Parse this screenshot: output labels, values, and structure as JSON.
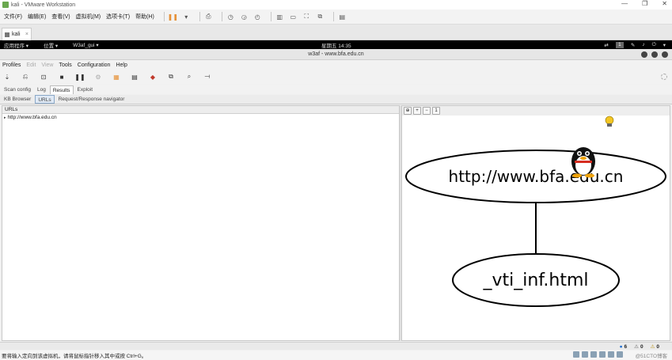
{
  "vmware": {
    "window_title": "kali - VMware Workstation",
    "menu": [
      "文件(F)",
      "编辑(E)",
      "查看(V)",
      "虚拟机(M)",
      "选项卡(T)",
      "帮助(H)"
    ],
    "tab_label": "kali",
    "tab_close": "×",
    "status_text": "要将输入定向到该虚拟机，请将鼠标指针移入其中或按 Ctrl+G。",
    "watermark": "@51CTO博客"
  },
  "gnome_panel": {
    "applications": "应用程序 ▾",
    "places": "位置 ▾",
    "active_app": "W3af_gui ▾",
    "clock": "星期五 14:35",
    "workspace": "1"
  },
  "w3af": {
    "window_title": "w3af - www.bfa.edu.cn",
    "menu": {
      "profiles": "Profiles",
      "edit": "Edit",
      "view": "View",
      "tools": "Tools",
      "configuration": "Configuration",
      "help": "Help"
    },
    "main_tabs": {
      "scan_config": "Scan config",
      "log": "Log",
      "results": "Results",
      "exploit": "Exploit"
    },
    "sub_tabs": {
      "kb_browser": "KB Browser",
      "urls": "URLs",
      "request_response": "Request/Response navigator"
    },
    "tree": {
      "column_header": "URLs",
      "items": [
        "http://www.bfa.edu.cn"
      ]
    },
    "graph": {
      "root_node": "http://www.bfa.edu.cn",
      "child_node": "_vti_inf.html"
    },
    "status_counts": {
      "info": "6",
      "warnings": "0",
      "errors": "0"
    }
  }
}
